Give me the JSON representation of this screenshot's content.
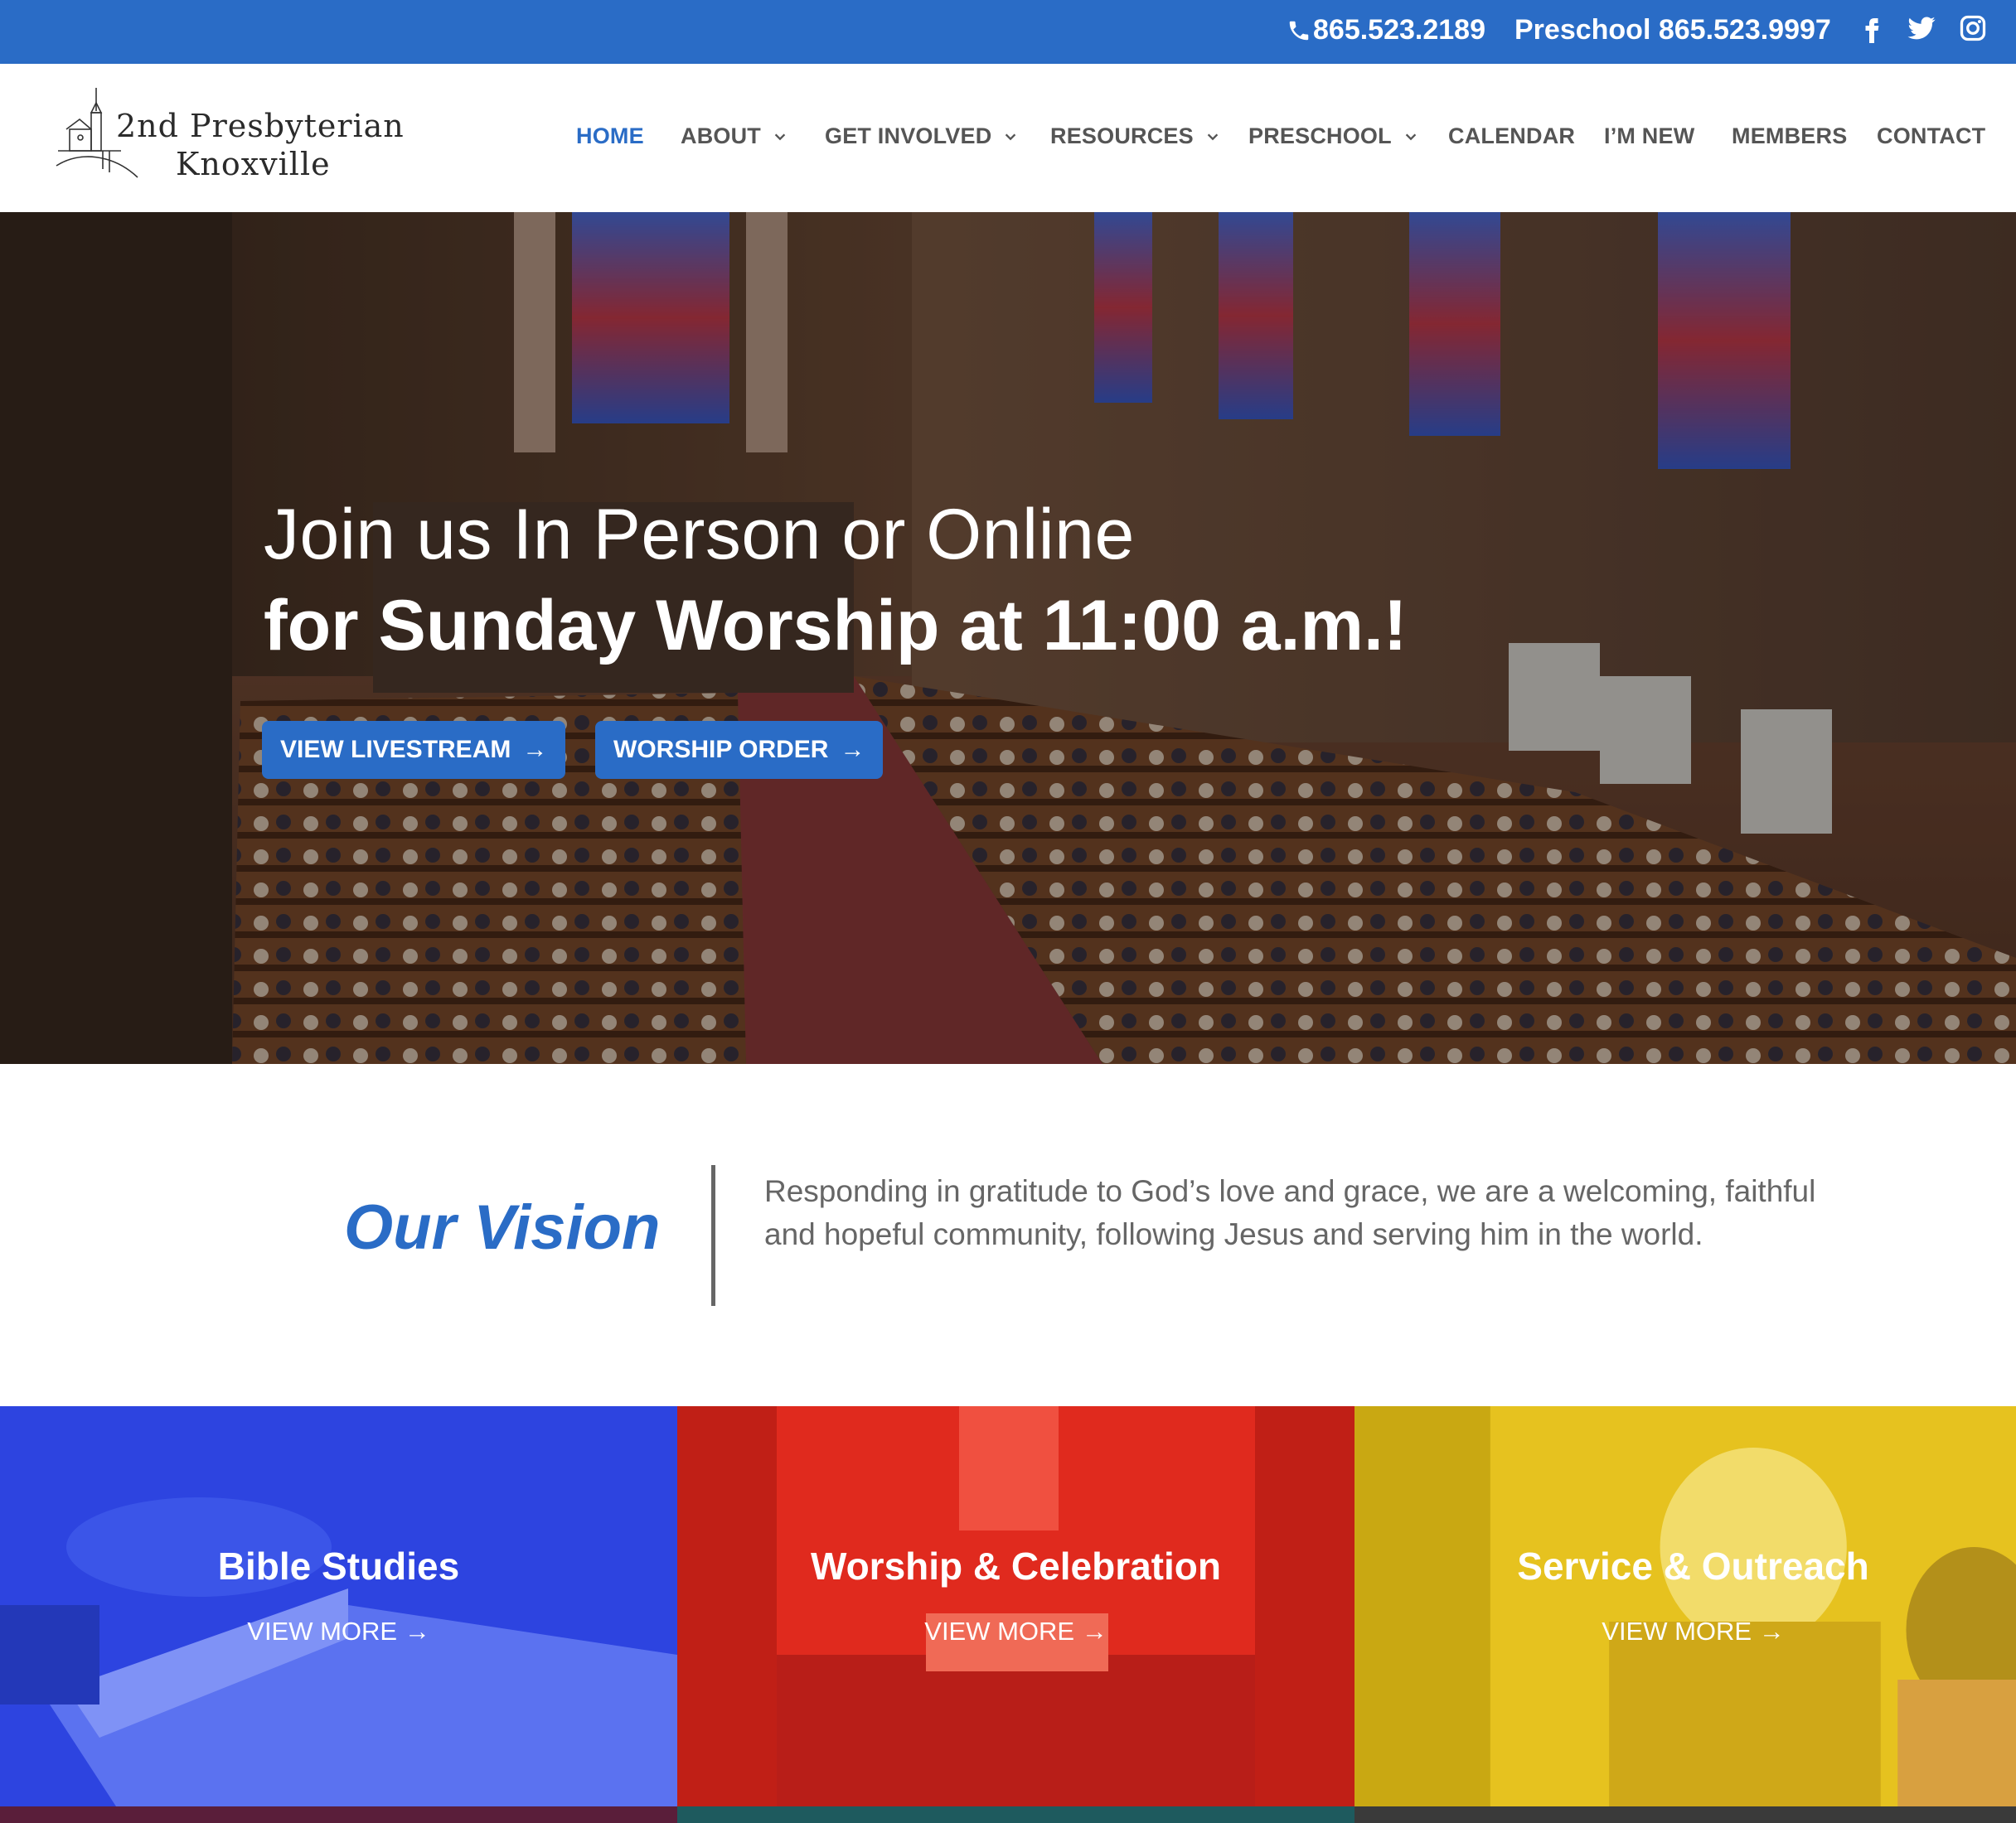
{
  "topbar": {
    "phone": "865.523.2189",
    "preschool": "Preschool 865.523.9997",
    "social_icons": [
      "facebook-icon",
      "twitter-icon",
      "instagram-icon"
    ],
    "color": "#2a6cc6"
  },
  "logo": {
    "line1": "2nd Presbyterian",
    "line2": "Knoxville"
  },
  "nav": {
    "items": [
      {
        "label": "HOME",
        "active": true
      },
      {
        "label": "ABOUT",
        "dropdown": true
      },
      {
        "label": "GET INVOLVED",
        "dropdown": true
      },
      {
        "label": "RESOURCES",
        "dropdown": true
      },
      {
        "label": "PRESCHOOL",
        "dropdown": true
      },
      {
        "label": "CALENDAR"
      },
      {
        "label": "I’M NEW"
      },
      {
        "label": "MEMBERS"
      },
      {
        "label": "CONTACT"
      }
    ]
  },
  "hero": {
    "line1": "Join us In Person or Online",
    "line2": "for Sunday Worship at 11:00 a.m.!",
    "buttons": [
      {
        "label": "VIEW LIVESTREAM",
        "icon": "arrow-right-icon"
      },
      {
        "label": "WORSHIP ORDER",
        "icon": "arrow-right-icon"
      }
    ]
  },
  "vision": {
    "title": "Our Vision",
    "text": "Responding in gratitude to God’s love and grace, we are a welcoming, faithful and hopeful community, following Jesus and serving him in the world."
  },
  "tiles": [
    {
      "title": "Bible Studies",
      "link": "VIEW MORE",
      "color": "#2d44e0"
    },
    {
      "title": "Worship & Celebration",
      "link": "VIEW MORE",
      "color": "#e02a1e"
    },
    {
      "title": "Service & Outreach",
      "link": "VIEW MORE",
      "color": "#e6c21f"
    }
  ],
  "colors": {
    "accent": "#2a6cc6",
    "nav_text": "#555555",
    "body_text": "#666666"
  }
}
